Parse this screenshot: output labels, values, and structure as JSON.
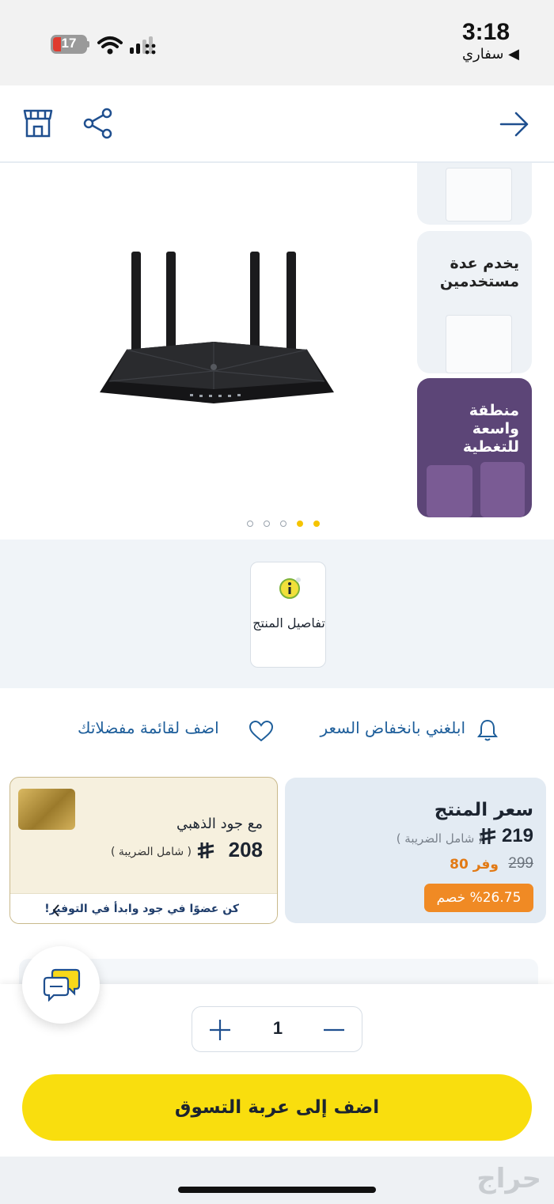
{
  "status_bar": {
    "time": "3:18",
    "back_app": "◀ سفاري",
    "battery_level": "17",
    "icons": [
      "signal-icon",
      "wifi-icon",
      "battery-icon"
    ]
  },
  "nav": {
    "icons": [
      "forward-arrow-icon",
      "share-icon",
      "store-icon"
    ]
  },
  "gallery": {
    "thumbs": [
      {
        "label": ""
      },
      {
        "label": "يخدم عدة مستخدمين"
      },
      {
        "label": "منطقة واسعة للتغطية"
      }
    ],
    "dot_count": 5,
    "active_dots": [
      3,
      4
    ],
    "colors": {
      "dot_active": "#f5c400",
      "dot_inactive": "#9aa3ad"
    }
  },
  "details": {
    "label": "تفاصيل المنتج"
  },
  "actions": {
    "price_alert": "ابلغني بانخفاض السعر",
    "wishlist": "اضف لقائمة مفضلاتك"
  },
  "price": {
    "title": "سعر المنتج",
    "current": "219",
    "vat_note": "( شامل الضريبة )",
    "old": "299",
    "saving": "وفر  80",
    "discount": "%26.75 خصم"
  },
  "gold": {
    "title": "مع جود الذهبي",
    "price": "208",
    "vat_note": "( شامل الضريبة )",
    "footer": "كن عضوًا في جود وابدأ في التوفير!"
  },
  "cart": {
    "quantity": "1",
    "add_to_cart": "اضف إلى عربة التسوق"
  },
  "watermark": "حراج",
  "colors": {
    "accent_yellow": "#f9de0e",
    "link_blue": "#1f5f9b",
    "discount_orange": "#f08a24"
  }
}
